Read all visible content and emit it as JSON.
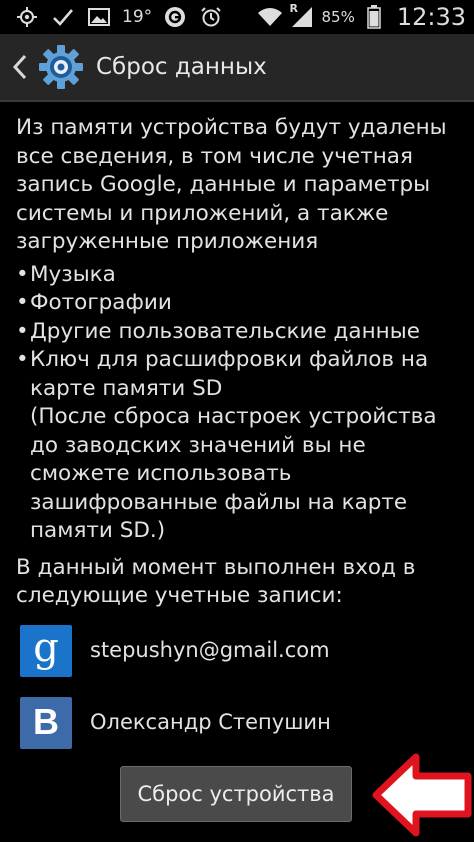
{
  "statusbar": {
    "temperature": "19°",
    "battery_percent": "85%",
    "clock": "12:33",
    "signal_badge": "R",
    "icons": [
      "gps-icon",
      "check-icon",
      "image-icon",
      "temperature",
      "app-icon",
      "alarm-icon",
      "wifi-icon",
      "signal-icon",
      "battery-icon"
    ]
  },
  "actionbar": {
    "title": "Сброс данных"
  },
  "content": {
    "intro": "Из памяти устройства будут удалены все сведения, в том числе учетная запись Google, данные и параметры системы и приложений, а также загруженные приложения",
    "bullets": [
      "Музыка",
      "Фотографии",
      "Другие пользовательские данные",
      "Ключ для расшифровки файлов на карте памяти SD"
    ],
    "sd_note": "(После сброса настроек устройства до заводских значений вы не сможете использовать зашифрованные файлы на карте памяти SD.)",
    "accounts_intro": "В данный момент выполнен вход в следующие учетные записи:",
    "accounts": [
      {
        "icon": "google-icon",
        "icon_letter": "g",
        "label": "stepushyn@gmail.com"
      },
      {
        "icon": "vk-icon",
        "icon_letter": "B",
        "label": "Олександр Степушин"
      }
    ]
  },
  "reset_button": {
    "label": "Сброс устройства"
  },
  "colors": {
    "background": "#000000",
    "actionbar": "#262626",
    "google_blue": "#1a74c9",
    "vk_blue": "#3d6aa8",
    "button": "#4a4a4a",
    "arrow_red": "#e0141e"
  }
}
